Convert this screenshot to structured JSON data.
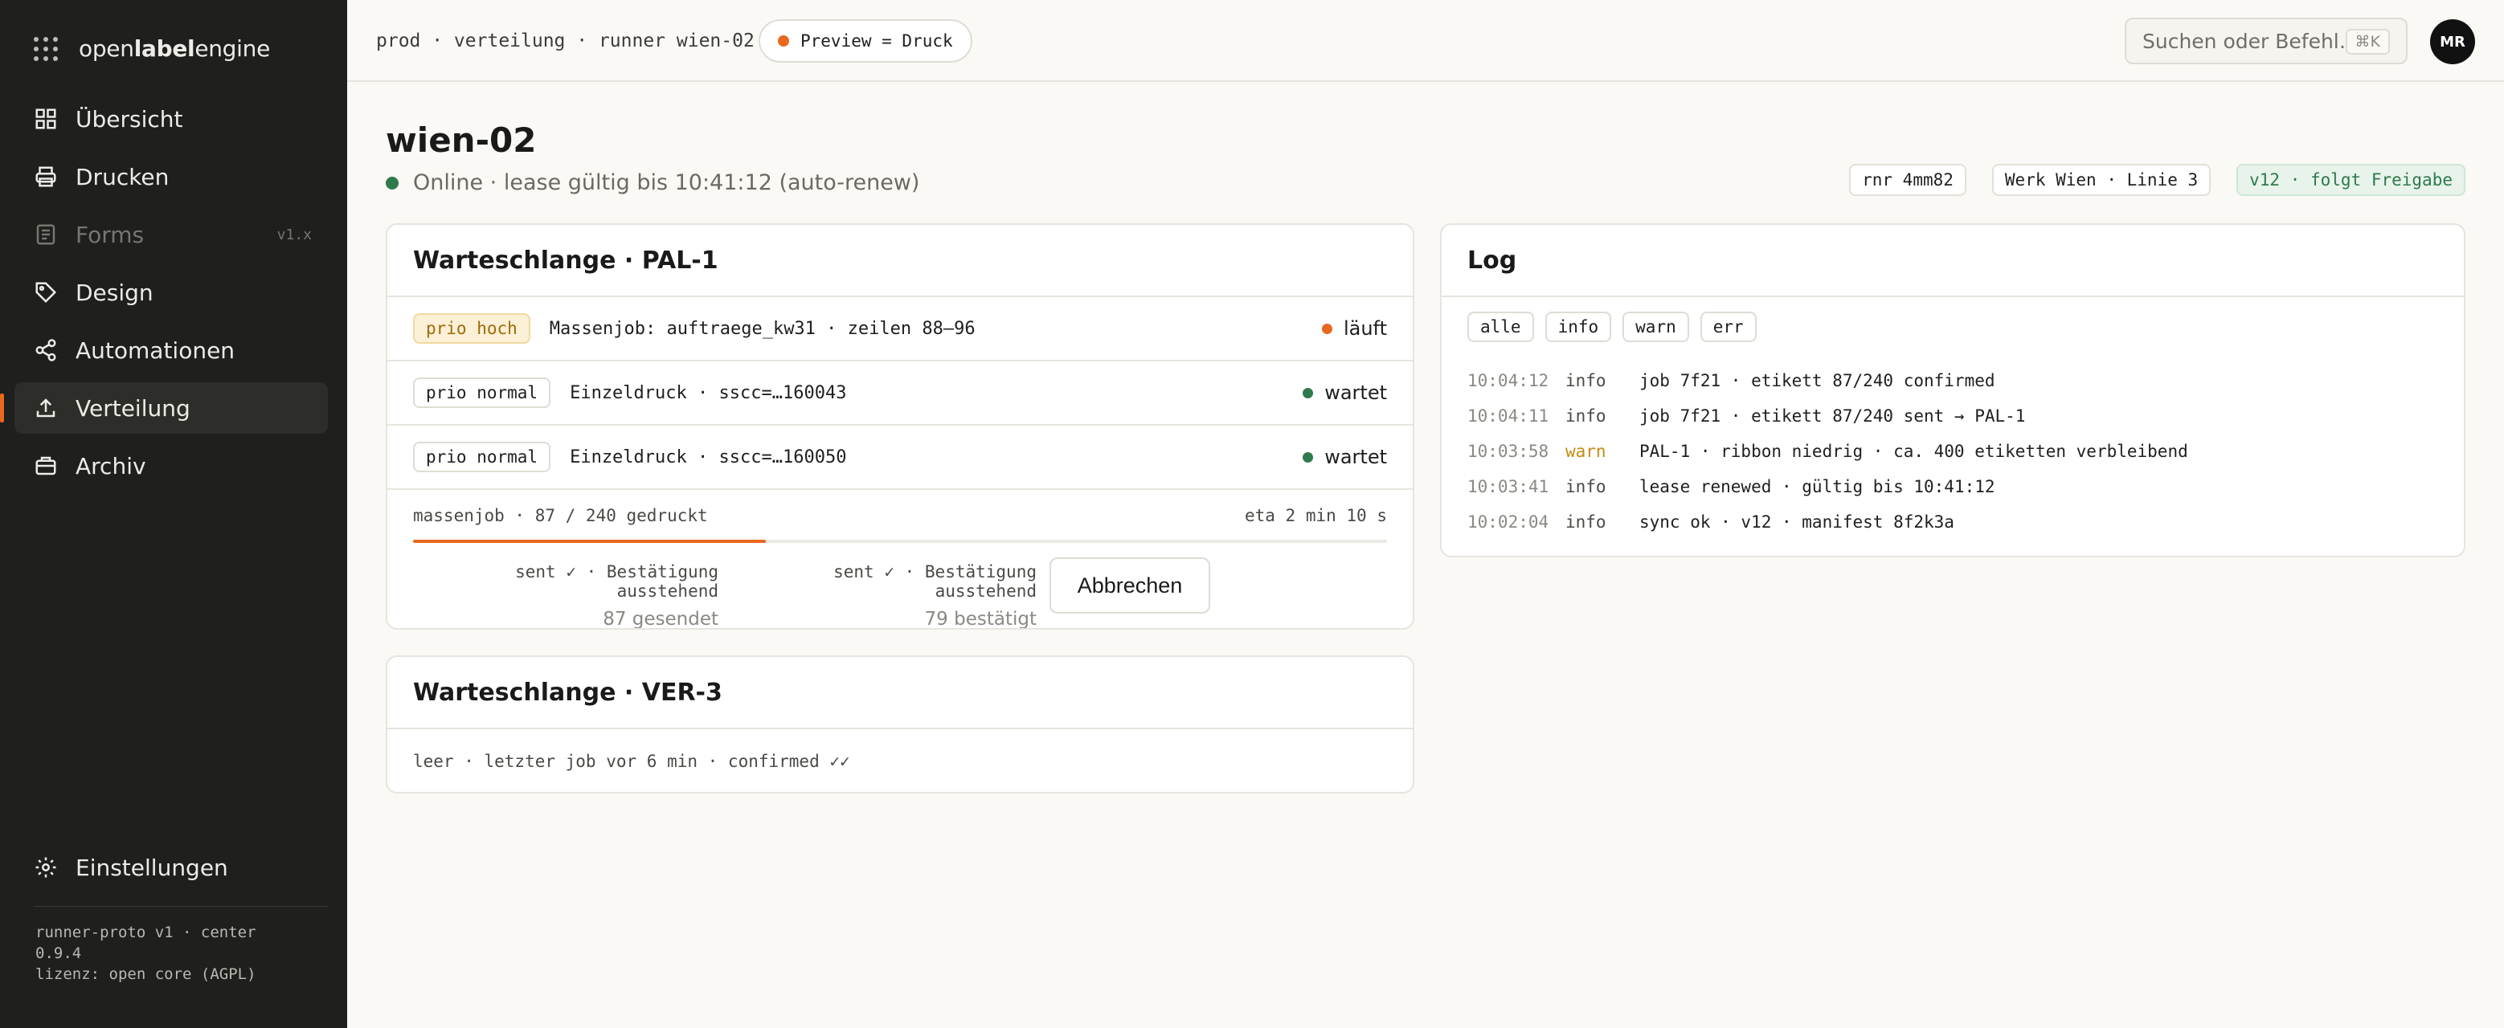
{
  "app": {
    "logo_prefix": "open",
    "logo_bold": "label",
    "logo_suffix": "engine"
  },
  "sidebar": {
    "items": [
      {
        "label": "Übersicht",
        "icon": "grid-icon"
      },
      {
        "label": "Drucken",
        "icon": "printer-icon"
      },
      {
        "label": "Forms",
        "icon": "form-icon",
        "badge": "v1.x",
        "disabled": true
      },
      {
        "label": "Design",
        "icon": "tag-icon"
      },
      {
        "label": "Automationen",
        "icon": "share-icon"
      },
      {
        "label": "Verteilung",
        "icon": "upload-icon",
        "active": true
      },
      {
        "label": "Archiv",
        "icon": "archive-icon"
      }
    ],
    "settings_label": "Einstellungen",
    "footer_line1": "runner-proto v1 · center",
    "footer_line2": "0.9.4",
    "footer_line3": "lizenz: open core (AGPL)"
  },
  "topbar": {
    "breadcrumb": "prod · verteilung · runner wien-02",
    "preview_label": "Preview = Druck",
    "search_placeholder": "Suchen oder Befehl…",
    "search_shortcut": "⌘K",
    "avatar_initials": "MR"
  },
  "page": {
    "title": "wien-02",
    "status_text": "Online · lease gültig bis 10:41:12 (auto-renew)",
    "tags": [
      "rnr 4mm82",
      "Werk Wien · Linie 3",
      "v12 · folgt Freigabe"
    ]
  },
  "queue_pal": {
    "title": "Warteschlange · PAL-1",
    "rows": [
      {
        "prio": "prio hoch",
        "job": "Massenjob: auftraege_kw31 · zeilen 88–96",
        "status": "läuft"
      },
      {
        "prio": "prio normal",
        "job": "Einzeldruck · sscc=…160043",
        "status": "wartet"
      },
      {
        "prio": "prio normal",
        "job": "Einzeldruck · sscc=…160050",
        "status": "wartet"
      }
    ],
    "progress_label": "massenjob · 87 / 240 gedruckt",
    "progress_eta": "eta 2 min 10 s",
    "progress_fraction": 0.3625,
    "ack_sent_label": "sent ✓ · Bestätigung ausstehend",
    "ack_sent_count": "87 gesendet",
    "ack_confirmed_label": "sent ✓ · Bestätigung ausstehend",
    "ack_confirmed_count": "79 bestätigt",
    "cancel_label": "Abbrechen"
  },
  "queue_ver": {
    "title": "Warteschlange · VER-3",
    "empty_text": "leer · letzter job vor 6 min · confirmed ✓✓"
  },
  "log": {
    "title": "Log",
    "filters": [
      "alle",
      "info",
      "warn",
      "err"
    ],
    "lines": [
      {
        "time": "10:04:12",
        "level": "info",
        "msg": "job 7f21 · etikett 87/240 confirmed"
      },
      {
        "time": "10:04:11",
        "level": "info",
        "msg": "job 7f21 · etikett 87/240 sent → PAL-1"
      },
      {
        "time": "10:03:58",
        "level": "warn",
        "msg": "PAL-1 · ribbon niedrig · ca. 400 etiketten verbleibend"
      },
      {
        "time": "10:03:41",
        "level": "info",
        "msg": "lease renewed · gültig bis 10:41:12"
      },
      {
        "time": "10:02:04",
        "level": "info",
        "msg": "sync ok · v12 · manifest 8f2k3a"
      }
    ]
  },
  "colors": {
    "accent": "#e8681e",
    "online": "#2f7a4b",
    "warn": "#c58a12",
    "sidebar_bg": "#1f1f1d"
  }
}
